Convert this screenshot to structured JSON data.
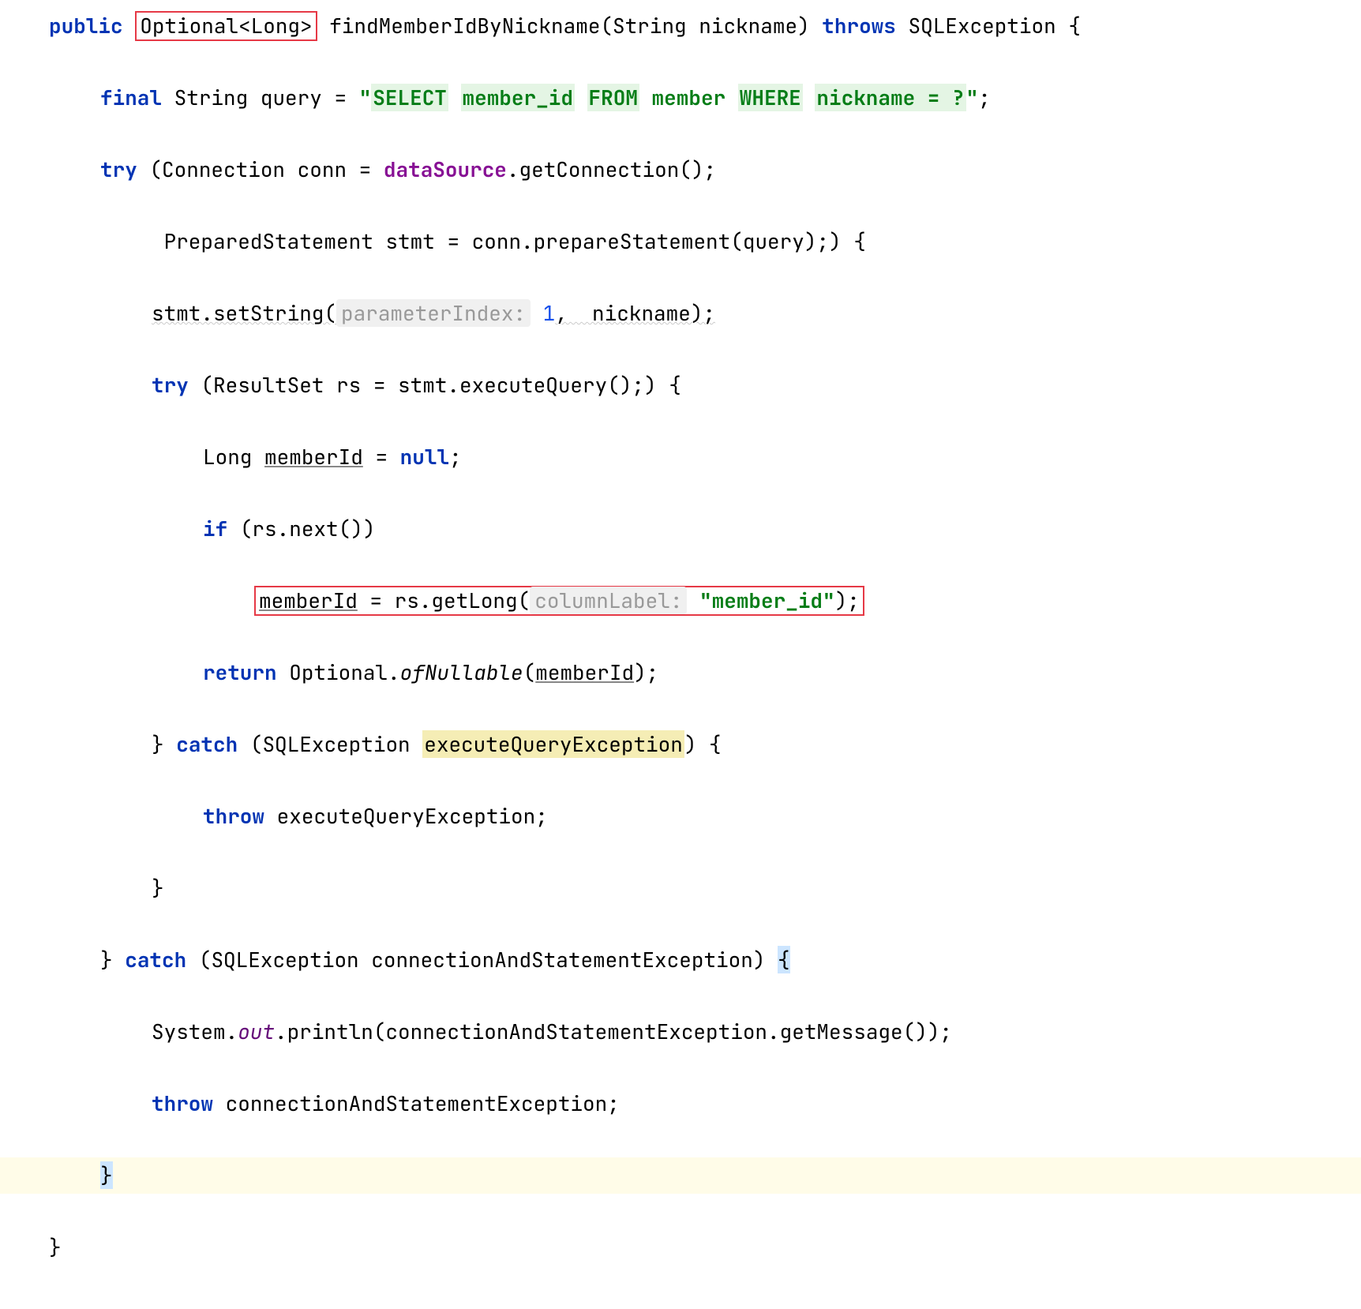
{
  "line1": {
    "kw_public": "public",
    "ret_type": "Optional<Long>",
    "method": "findMemberIdByNickname",
    "param_type": "String",
    "param_name": "nickname",
    "kw_throws": "throws",
    "exception": "SQLException",
    "brace": "{"
  },
  "line2": {
    "kw_final": "final",
    "type": "String",
    "var": "query",
    "eq": "=",
    "q1": "\"",
    "sql_select": "SELECT",
    "sql_col": "member_id",
    "sql_from": "FROM",
    "sql_table": "member",
    "sql_where": "WHERE",
    "sql_cond": "nickname = ?",
    "q2": "\"",
    "semi": ";"
  },
  "line3": {
    "kw_try": "try",
    "open": "(",
    "type": "Connection",
    "var": "conn",
    "eq": "=",
    "ds": "dataSource",
    "method": ".getConnection();"
  },
  "line4": {
    "type": "PreparedStatement",
    "var": "stmt",
    "eq": "=",
    "rest": "conn.prepareStatement(query);) {"
  },
  "line5": {
    "call": "stmt.setString(",
    "hint_label": "parameterIndex:",
    "hint_val": "1",
    "tail": ",  nickname);"
  },
  "line6": {
    "kw_try": "try",
    "rest": "(ResultSet rs = stmt.executeQuery();) {"
  },
  "line7": {
    "type": "Long",
    "var": "memberId",
    "eq": "=",
    "kw_null": "null",
    "semi": ";"
  },
  "line8": {
    "kw_if": "if",
    "rest": "(rs.next())"
  },
  "line9": {
    "var": "memberId",
    "rest1": " = rs.getLong(",
    "hint": "columnLabel:",
    "str": "\"member_id\"",
    "tail": ");"
  },
  "line10": {
    "kw_return": "return",
    "class": "Optional.",
    "method": "ofNullable",
    "open": "(",
    "var": "memberId",
    "close": ");"
  },
  "line11": {
    "brace": "}",
    "kw_catch": "catch",
    "open": "(SQLException ",
    "var": "executeQueryException",
    "close": ") {"
  },
  "line12": {
    "kw_throw": "throw",
    "rest": "executeQueryException;"
  },
  "line13": {
    "brace": "}"
  },
  "line14": {
    "brace": "}",
    "kw_catch": "catch",
    "rest_open": "(SQLException connectionAndStatementException) ",
    "hl_brace": "{"
  },
  "line15": {
    "sys": "System.",
    "out": "out",
    "rest": ".println(connectionAndStatementException.getMessage());"
  },
  "line16": {
    "kw_throw": "throw",
    "rest": "connectionAndStatementException;"
  },
  "line17": {
    "brace": "}"
  },
  "line18": {
    "brace": "}"
  }
}
